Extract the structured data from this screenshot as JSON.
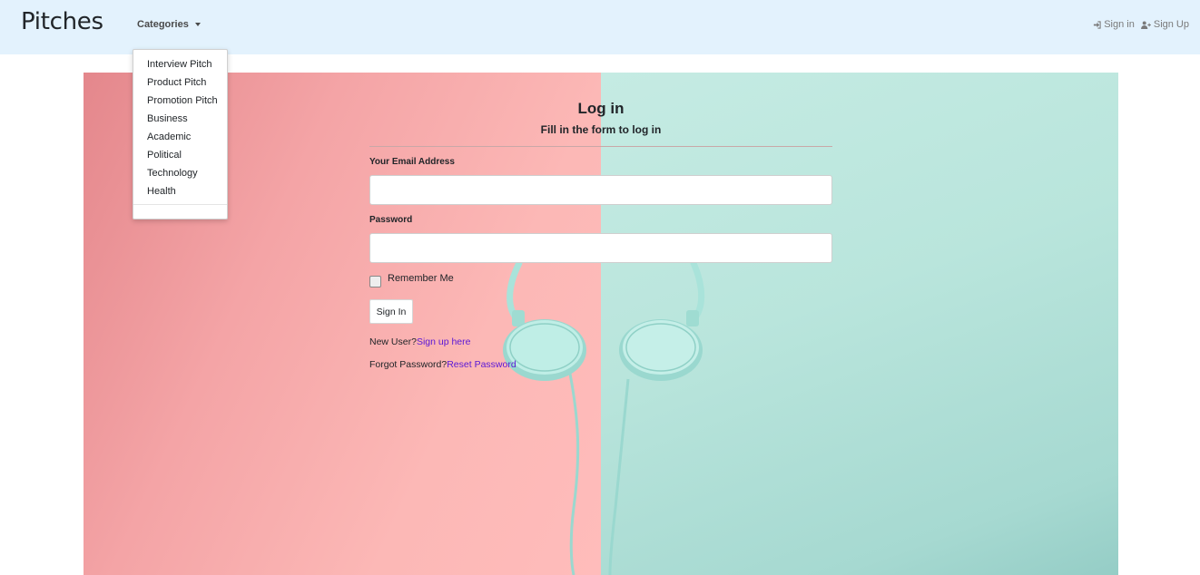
{
  "navbar": {
    "brand": "Pitches",
    "categories_label": "Categories",
    "sign_in": "Sign in",
    "sign_up": "Sign Up"
  },
  "dropdown": {
    "items": [
      "Interview Pitch",
      "Product Pitch",
      "Promotion Pitch",
      "Business",
      "Academic",
      "Political",
      "Technology",
      "Health"
    ]
  },
  "form": {
    "title": "Log in",
    "subtitle": "Fill in the form to log in",
    "email_label": "Your Email Address",
    "password_label": "Password",
    "remember_label": "Remember Me",
    "submit_label": "Sign In",
    "new_user_text": "New User?",
    "signup_link": "Sign up here",
    "forgot_text": "Forgot Password?",
    "reset_link": "Reset Password"
  },
  "icons": {
    "sign_in": "sign-in-icon",
    "sign_up": "user-plus-icon",
    "caret": "caret-down-icon"
  },
  "colors": {
    "navbar_bg": "#e3f2fd",
    "link": "#5a17d6"
  }
}
